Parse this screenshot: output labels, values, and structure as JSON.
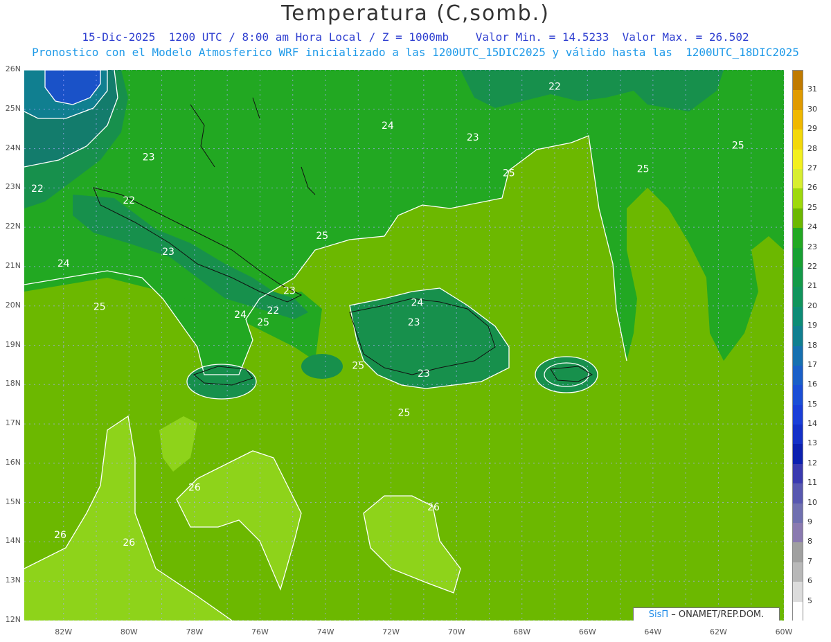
{
  "header": {
    "title": "Temperatura (C,somb.)",
    "line1": "15-Dic-2025  1200 UTC / 8:00 am Hora Local / Z = 1000mb    Valor Min. = 14.5233  Valor Max. = 26.502",
    "line2": "Pronostico con el Modelo Atmosferico WRF inicializado a las 1200UTC_15DIC2025 y válido hasta las  1200UTC_18DIC2025"
  },
  "axes": {
    "lat_labels": [
      "26N",
      "25N",
      "24N",
      "23N",
      "22N",
      "21N",
      "20N",
      "19N",
      "18N",
      "17N",
      "16N",
      "15N",
      "14N",
      "13N",
      "12N"
    ],
    "lon_labels": [
      "82W",
      "80W",
      "78W",
      "76W",
      "74W",
      "72W",
      "70W",
      "68W",
      "66W",
      "64W",
      "62W",
      "60W"
    ]
  },
  "contour_labels": [
    {
      "text": "22",
      "lon": -82.8,
      "lat": 22.9
    },
    {
      "text": "23",
      "lon": -79.4,
      "lat": 23.7
    },
    {
      "text": "22",
      "lon": -80.0,
      "lat": 22.6
    },
    {
      "text": "23",
      "lon": -78.8,
      "lat": 21.3
    },
    {
      "text": "24",
      "lon": -82.0,
      "lat": 21.0
    },
    {
      "text": "25",
      "lon": -80.9,
      "lat": 19.9
    },
    {
      "text": "25",
      "lon": -74.1,
      "lat": 21.7
    },
    {
      "text": "23",
      "lon": -75.1,
      "lat": 20.3
    },
    {
      "text": "22",
      "lon": -75.6,
      "lat": 19.8
    },
    {
      "text": "24",
      "lon": -76.6,
      "lat": 19.7
    },
    {
      "text": "25",
      "lon": -75.9,
      "lat": 19.5
    },
    {
      "text": "24",
      "lon": -72.1,
      "lat": 24.5
    },
    {
      "text": "23",
      "lon": -69.5,
      "lat": 24.2
    },
    {
      "text": "22",
      "lon": -67.0,
      "lat": 25.5
    },
    {
      "text": "25",
      "lon": -68.4,
      "lat": 23.3
    },
    {
      "text": "25",
      "lon": -64.3,
      "lat": 23.4
    },
    {
      "text": "25",
      "lon": -61.4,
      "lat": 24.0
    },
    {
      "text": "24",
      "lon": -71.2,
      "lat": 20.0
    },
    {
      "text": "23",
      "lon": -71.3,
      "lat": 19.5
    },
    {
      "text": "25",
      "lon": -73.0,
      "lat": 18.4
    },
    {
      "text": "23",
      "lon": -71.0,
      "lat": 18.2
    },
    {
      "text": "25",
      "lon": -71.6,
      "lat": 17.2
    },
    {
      "text": "26",
      "lon": -78.0,
      "lat": 15.3
    },
    {
      "text": "26",
      "lon": -82.1,
      "lat": 14.1
    },
    {
      "text": "26",
      "lon": -80.0,
      "lat": 13.9
    },
    {
      "text": "26",
      "lon": -70.7,
      "lat": 14.8
    }
  ],
  "colorbar": {
    "levels": [
      "31",
      "30",
      "29",
      "28",
      "27",
      "26",
      "25",
      "24",
      "23",
      "22",
      "21",
      "20",
      "19",
      "18",
      "17",
      "16",
      "15",
      "14",
      "13",
      "12",
      "11",
      "10",
      "9",
      "8",
      "7",
      "6",
      "5"
    ],
    "colors": [
      "#c07a00",
      "#e09a00",
      "#f0b800",
      "#f3d80a",
      "#f3f020",
      "#d8ee30",
      "#9ed90c",
      "#6cb800",
      "#22a822",
      "#17a032",
      "#139a48",
      "#10945c",
      "#0d8c76",
      "#107f90",
      "#1670b0",
      "#1a5fc8",
      "#1b4ed6",
      "#1a3ed8",
      "#1430c8",
      "#0c20b0",
      "#3a3ab0",
      "#5858b0",
      "#7070b0",
      "#8a7ab0",
      "#a0a0a0",
      "#b8b8b8",
      "#dcdcdc"
    ],
    "bottom_color": "#ffffff"
  },
  "credit": {
    "brand": "SisΠ",
    "text": " – ONAMET/REP.DOM."
  },
  "legend_colors": {
    "light_green": "#8ed31a",
    "mid_green": "#6cb800",
    "green": "#22a822",
    "teal": "#17904c",
    "deep_teal": "#137c6c",
    "blue": "#1a52c8",
    "grid": "#aaaaff"
  }
}
